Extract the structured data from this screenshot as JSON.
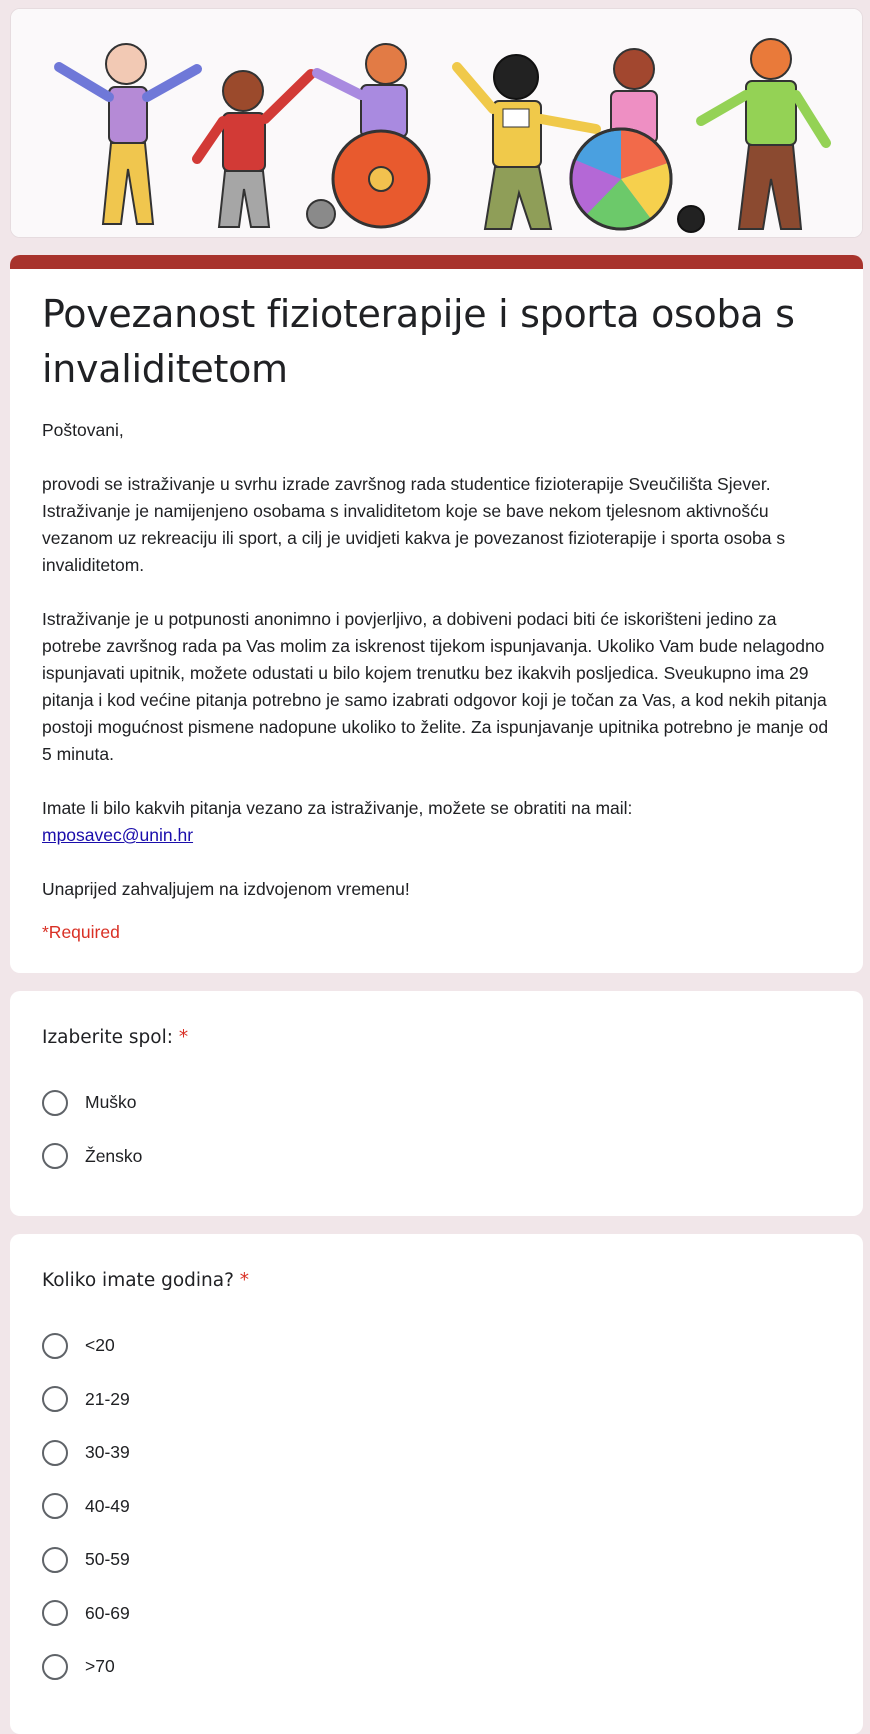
{
  "form": {
    "title": "Povezanost fizioterapije i sporta osoba s invaliditetom",
    "greeting": "Poštovani,",
    "paragraph1": "provodi se istraživanje u svrhu izrade završnog rada studentice fizioterapije Sveučilišta Sjever. Istraživanje je namijenjeno osobama s invaliditetom koje se bave nekom tjelesnom aktivnošću vezanom uz rekreaciju ili sport, a cilj je uvidjeti kakva je povezanost fizioterapije i sporta osoba s invaliditetom.",
    "paragraph2": "Istraživanje je u potpunosti anonimno i povjerljivo, a dobiveni podaci biti će iskorišteni jedino za potrebe završnog rada pa Vas molim za iskrenost tijekom ispunjavanja. Ukoliko Vam bude nelagodno ispunjavati upitnik, možete odustati u bilo kojem trenutku bez ikakvih posljedica. Sveukupno ima 29 pitanja i kod većine pitanja potrebno je samo izabrati odgovor koji je točan za Vas, a kod nekih pitanja postoji mogućnost pismene nadopune ukoliko to želite. Za ispunjavanje upitnika potrebno je manje od 5 minuta.",
    "contact_text": "Imate li bilo kakvih pitanja vezano za istraživanje, možete se obratiti na mail:",
    "contact_email": "mposavec@unin.hr",
    "thanks": "Unaprijed zahvaljujem na izdvojenom vremenu!",
    "required_note": "*Required"
  },
  "questions": {
    "gender": {
      "title": "Izaberite spol:",
      "required_mark": "*",
      "options": [
        "Muško",
        "Žensko"
      ]
    },
    "age": {
      "title": "Koliko imate godina?",
      "required_mark": "*",
      "options": [
        "<20",
        "21-29",
        "30-39",
        "40-49",
        "50-59",
        "60-69",
        ">70"
      ]
    }
  },
  "colors": {
    "background": "#f1e6e9",
    "accent_bar": "#a8332c",
    "required": "#d93025",
    "link": "#1a0dab"
  }
}
